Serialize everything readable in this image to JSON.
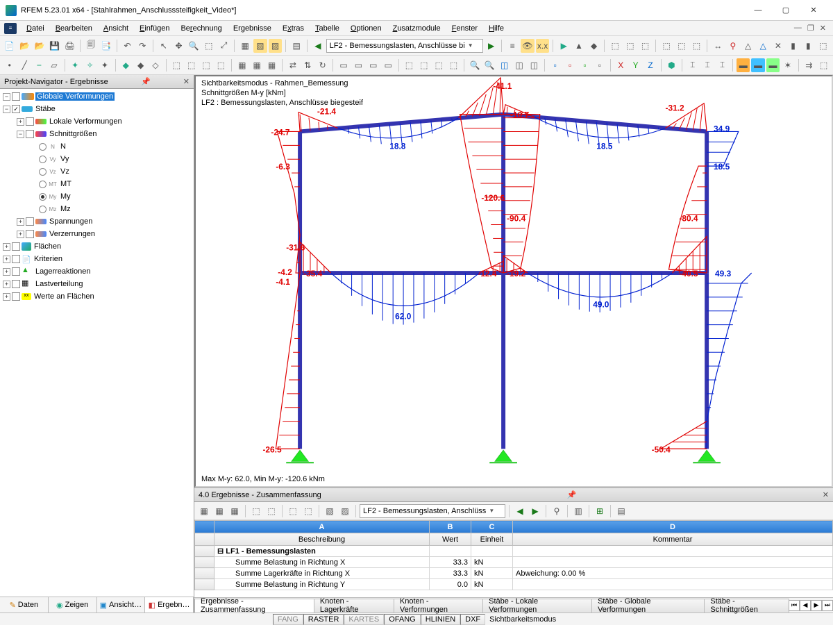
{
  "window": {
    "title": "RFEM 5.23.01 x64 - [Stahlrahmen_Anschlusssteifigkeit_Video*]"
  },
  "menu": {
    "items": [
      "Datei",
      "Bearbeiten",
      "Ansicht",
      "Einfügen",
      "Berechnung",
      "Ergebnisse",
      "Extras",
      "Tabelle",
      "Optionen",
      "Zusatzmodule",
      "Fenster",
      "Hilfe"
    ]
  },
  "toolbar": {
    "loadcase_selector": "LF2 - Bemessungslasten, Anschlüsse bi"
  },
  "navigator": {
    "title": "Projekt-Navigator - Ergebnisse",
    "tabs": [
      "Daten",
      "Zeigen",
      "Ansicht…",
      "Ergebn…"
    ],
    "active_tab": 3,
    "top": [
      {
        "label": "Globale Verformungen",
        "selected": true
      },
      {
        "label": "Stäbe",
        "checked": true,
        "expanded": true,
        "children": [
          {
            "label": "Lokale Verformungen"
          },
          {
            "label": "Schnittgrößen",
            "expanded": true,
            "children": [
              {
                "label": "N",
                "radio": false,
                "sym": "N"
              },
              {
                "label": "Vy",
                "radio": false,
                "sym": "Vy"
              },
              {
                "label": "Vz",
                "radio": false,
                "sym": "Vz"
              },
              {
                "label": "MT",
                "radio": false,
                "sym": "MT"
              },
              {
                "label": "My",
                "radio": true,
                "sym": "My"
              },
              {
                "label": "Mz",
                "radio": false,
                "sym": "Mz"
              }
            ]
          },
          {
            "label": "Spannungen"
          },
          {
            "label": "Verzerrungen"
          }
        ]
      },
      {
        "label": "Flächen"
      },
      {
        "label": "Kriterien"
      },
      {
        "label": "Lagerreaktionen"
      },
      {
        "label": "Lastverteilung"
      },
      {
        "label": "Werte an Flächen"
      }
    ]
  },
  "canvas": {
    "info": [
      "Sichtbarkeitsmodus - Rahmen_Bemessung",
      "Schnittgrößen M-y [kNm]",
      "LF2 : Bemessungslasten, Anschlüsse biegesteif"
    ],
    "footer": "Max M-y: 62.0, Min M-y: -120.6 kNm",
    "values": {
      "c1_bot": "-26.5",
      "c1_mid_l": "-4.1",
      "c1_mid_r": "-4.2",
      "c1_up": "-6.3",
      "c1_top": "-24.7",
      "r1_top": "-21.4",
      "r1_mid": "18.8",
      "apex": "-41.1",
      "apex_r": "-10.7",
      "r2_mid": "18.5",
      "r2_top": "-31.2",
      "c2_top": "-120.6",
      "c2_top2": "-90.4",
      "c2_mid_l": "-12.4",
      "c2_mid_r": "-19.2",
      "c3_top": "34.9",
      "c3_up": "18.5",
      "c3_mid": "-80.4",
      "c3_beam": "-40.5",
      "c3_beam_r": "49.3",
      "c3_bot": "-50.4",
      "b1_v1": "-35.4",
      "b1_v2": "-31.6",
      "b1_mid": "62.0",
      "b2_mid": "49.0"
    }
  },
  "lower": {
    "title": "4.0 Ergebnisse - Zusammenfassung",
    "toolbar_select": "LF2 - Bemessungslasten, Anschlüss",
    "columns": {
      "A": "Beschreibung",
      "B": "Wert",
      "C": "Einheit",
      "D": "Kommentar"
    },
    "group_title": "LF1 - Bemessungslasten",
    "rows": [
      {
        "desc": "Summe Belastung in Richtung X",
        "wert": "33.3",
        "einheit": "kN",
        "kommentar": ""
      },
      {
        "desc": "Summe Lagerkräfte in Richtung X",
        "wert": "33.3",
        "einheit": "kN",
        "kommentar": "Abweichung:  0.00 %"
      },
      {
        "desc": "Summe Belastung in Richtung Y",
        "wert": "0.0",
        "einheit": "kN",
        "kommentar": ""
      }
    ],
    "tabs": [
      "Ergebnisse - Zusammenfassung",
      "Knoten - Lagerkräfte",
      "Knoten - Verformungen",
      "Stäbe - Lokale Verformungen",
      "Stäbe - Globale Verformungen",
      "Stäbe - Schnittgrößen"
    ]
  },
  "statusbar": {
    "cells": [
      "FANG",
      "RASTER",
      "KARTES",
      "OFANG",
      "HLINIEN",
      "DXF"
    ],
    "mode": "Sichtbarkeitsmodus"
  }
}
